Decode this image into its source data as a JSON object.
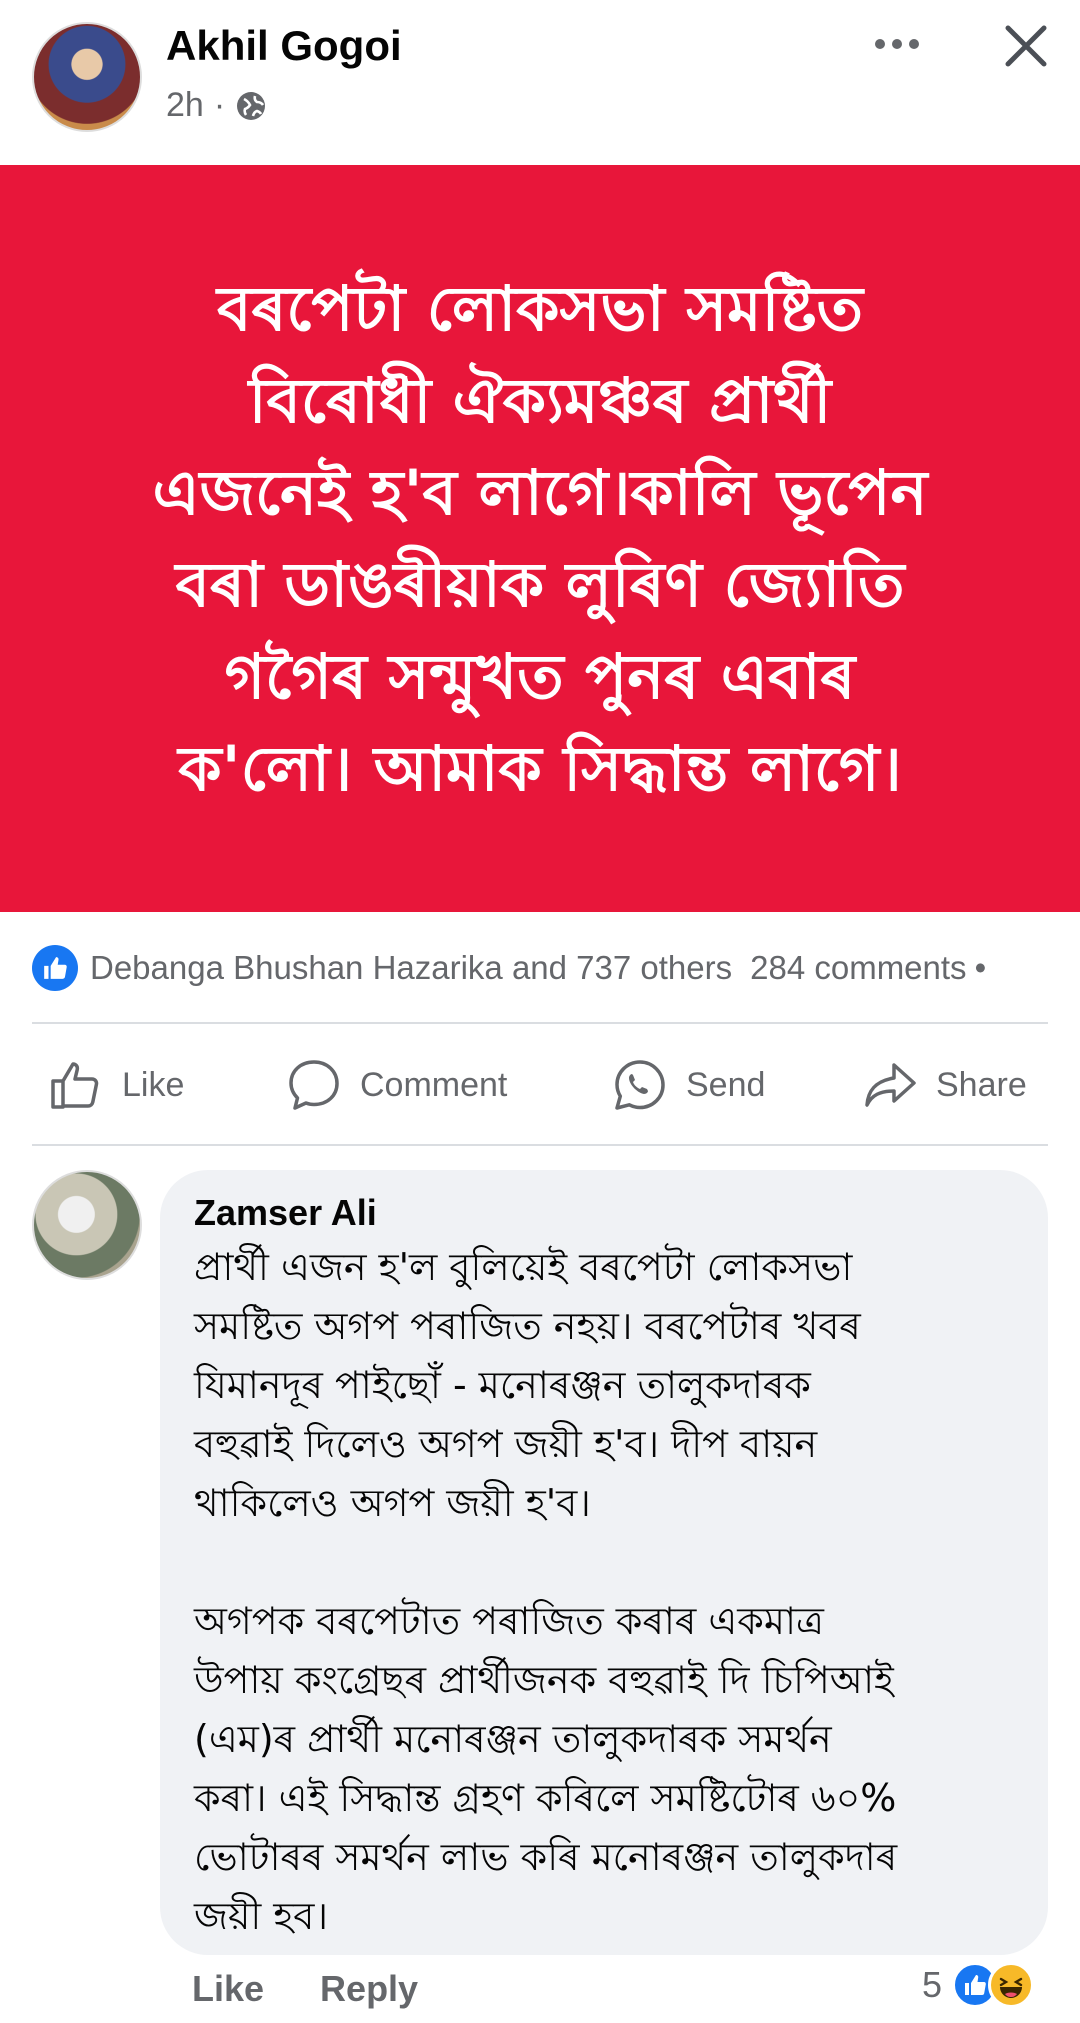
{
  "post": {
    "author": "Akhil Gogoi",
    "time": "2h",
    "separator": "·",
    "audience_icon": "globe-icon",
    "banner_bg": "#e8163a",
    "banner_text": "বৰপেটা লোকসভা সমষ্টিত\nবিৰোধী ঐক্যমঞ্চৰ প্ৰাৰ্থী\nএজনেই হ'ব লাগে।কালি ভূপেন\nবৰা ডাঙৰীয়াক লুৰিণ জ্যোতি\nগগৈৰ সন্মুখত পুনৰ এবাৰ\nক'লো। আমাক সিদ্ধান্ত লাগে।"
  },
  "reactions": {
    "names": "Debanga Bhushan Hazarika and 737 others",
    "comments": "284 comments",
    "dot": "•"
  },
  "actions": {
    "like": "Like",
    "comment": "Comment",
    "send": "Send",
    "share": "Share"
  },
  "comment": {
    "author": "Zamser Ali",
    "text": "প্ৰাৰ্থী এজন হ'ল বুলিয়েই বৰপেটা লোকসভা\nসমষ্টিত অগপ পৰাজিত নহয়। বৰপেটাৰ খবৰ\nযিমানদূৰ পাইছোঁ - মনোৰঞ্জন তালুকদাৰক\nবহুৱাই দিলেও অগপ জয়ী হ'ব। দীপ বায়ন\nথাকিলেও অগপ জয়ী হ'ব।\n\nঅগপক বৰপেটাত পৰাজিত কৰাৰ একমাত্ৰ\nউপায় কংগ্ৰেছৰ প্ৰাৰ্থীজনক বহুৱাই দি চিপিআই\n(এম)ৰ প্ৰাৰ্থী মনোৰঞ্জন তালুকদাৰক সমৰ্থন\nকৰা। এই সিদ্ধান্ত গ্ৰহণ কৰিলে সমষ্টিটোৰ ৬০%\nভোটাৰৰ সমৰ্থন লাভ কৰি মনোৰঞ্জন তালুকদাৰ\nজয়ী হব।",
    "like": "Like",
    "reply": "Reply",
    "reaction_count": "5"
  }
}
